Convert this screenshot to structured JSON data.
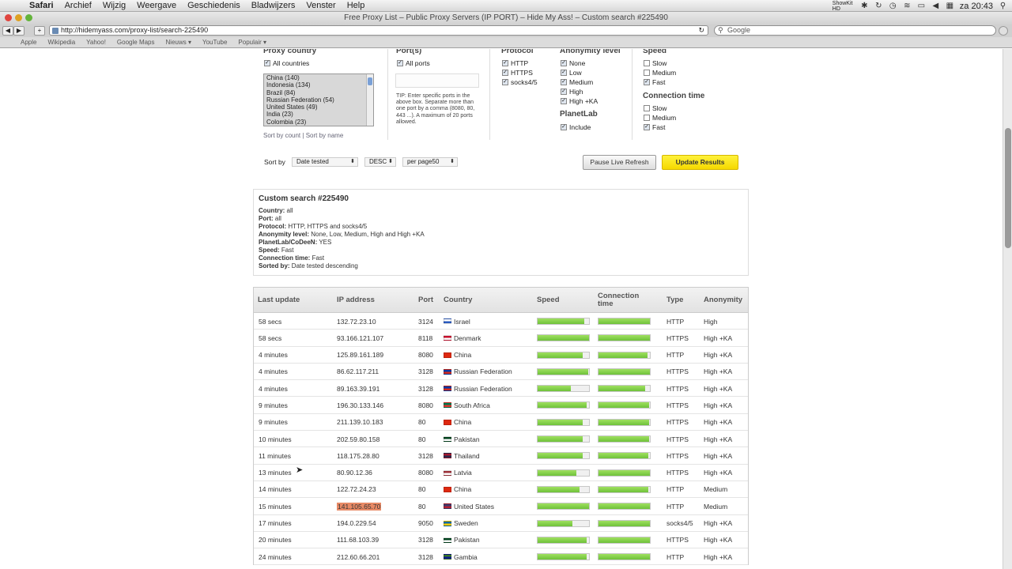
{
  "menubar": {
    "app": "Safari",
    "items": [
      "Archief",
      "Wijzig",
      "Weergave",
      "Geschiedenis",
      "Bladwijzers",
      "Venster",
      "Help"
    ],
    "clock": "za 20:43",
    "status_text": "ShowKit HD"
  },
  "window": {
    "title": "Free Proxy List – Public Proxy Servers (IP PORT) – Hide My Ass! – Custom search #225490"
  },
  "toolbar": {
    "url": "http://hidemyass.com/proxy-list/search-225490",
    "search_placeholder": "Google"
  },
  "bookmarks": [
    "Apple",
    "Wikipedia",
    "Yahoo!",
    "Google Maps",
    "Nieuws ▾",
    "YouTube",
    "Populair ▾"
  ],
  "filters": {
    "country_heading": "Proxy country",
    "all_countries": "All countries",
    "countries": [
      "China (140)",
      "Indonesia (134)",
      "Brazil (84)",
      "Russian Federation (54)",
      "United States (49)",
      "India (23)",
      "Colombia (23)"
    ],
    "sort_by_count": "Sort by count",
    "sort_sep": "|",
    "sort_by_name": "Sort by name",
    "port_heading": "Port(s)",
    "all_ports": "All ports",
    "port_tip": "TIP: Enter specific ports in the above box. Separate more than one port by a comma (8080, 80, 443 ...). A maximum of 20 ports allowed.",
    "protocol_heading": "Protocol",
    "protocols": [
      "HTTP",
      "HTTPS",
      "socks4/5"
    ],
    "anonymity_heading": "Anonymity level",
    "anonymity": [
      "None",
      "Low",
      "Medium",
      "High",
      "High +KA"
    ],
    "planetlab_heading": "PlanetLab",
    "planetlab_include": "Include",
    "speed_heading": "Speed",
    "speed": [
      {
        "label": "Slow",
        "checked": false
      },
      {
        "label": "Medium",
        "checked": false
      },
      {
        "label": "Fast",
        "checked": true
      }
    ],
    "conn_heading": "Connection time",
    "conn": [
      {
        "label": "Slow",
        "checked": false
      },
      {
        "label": "Medium",
        "checked": false
      },
      {
        "label": "Fast",
        "checked": true
      }
    ]
  },
  "sortbar": {
    "label": "Sort by",
    "field": "Date tested",
    "order": "DESC",
    "per_page": "per page50",
    "pause_button": "Pause Live Refresh",
    "update_button": "Update Results"
  },
  "summary": {
    "title": "Custom search #225490",
    "lines": [
      {
        "k": "Country:",
        "v": " all"
      },
      {
        "k": "Port:",
        "v": " all"
      },
      {
        "k": "Protocol:",
        "v": " HTTP, HTTPS and socks4/5"
      },
      {
        "k": "Anonymity level:",
        "v": " None, Low, Medium, High and High +KA"
      },
      {
        "k": "PlanetLab/CoDeeN:",
        "v": " YES"
      },
      {
        "k": "Speed:",
        "v": " Fast"
      },
      {
        "k": "Connection time:",
        "v": " Fast"
      },
      {
        "k": "Sorted by:",
        "v": " Date tested descending"
      }
    ]
  },
  "table": {
    "headers": [
      "Last update",
      "IP address",
      "Port",
      "Country",
      "Speed",
      "Connection time",
      "Type",
      "Anonymity"
    ],
    "rows": [
      {
        "update": "58 secs",
        "ip": "132.72.23.10",
        "port": "3124",
        "country": "Israel",
        "flag": [
          "#ffffff",
          "#2b5bbf"
        ],
        "speed": 0.9,
        "conn": 1.0,
        "type": "HTTP",
        "anon": "High"
      },
      {
        "update": "58 secs",
        "ip": "93.166.121.107",
        "port": "8118",
        "country": "Denmark",
        "flag": [
          "#c8102e",
          "#ffffff"
        ],
        "speed": 1.0,
        "conn": 1.0,
        "type": "HTTPS",
        "anon": "High +KA"
      },
      {
        "update": "4 minutes",
        "ip": "125.89.161.189",
        "port": "8080",
        "country": "China",
        "flag": [
          "#de2910",
          "#de2910"
        ],
        "speed": 0.87,
        "conn": 0.95,
        "type": "HTTP",
        "anon": "High +KA"
      },
      {
        "update": "4 minutes",
        "ip": "86.62.117.211",
        "port": "3128",
        "country": "Russian Federation",
        "flag": [
          "#0039a6",
          "#d52b1e"
        ],
        "speed": 0.98,
        "conn": 1.0,
        "type": "HTTPS",
        "anon": "High +KA"
      },
      {
        "update": "4 minutes",
        "ip": "89.163.39.191",
        "port": "3128",
        "country": "Russian Federation",
        "flag": [
          "#0039a6",
          "#d52b1e"
        ],
        "speed": 0.65,
        "conn": 0.9,
        "type": "HTTPS",
        "anon": "High +KA"
      },
      {
        "update": "9 minutes",
        "ip": "196.30.133.146",
        "port": "8080",
        "country": "South Africa",
        "flag": [
          "#007a4d",
          "#de3831"
        ],
        "speed": 0.95,
        "conn": 0.99,
        "type": "HTTPS",
        "anon": "High +KA"
      },
      {
        "update": "9 minutes",
        "ip": "211.139.10.183",
        "port": "80",
        "country": "China",
        "flag": [
          "#de2910",
          "#de2910"
        ],
        "speed": 0.88,
        "conn": 0.99,
        "type": "HTTPS",
        "anon": "High +KA"
      },
      {
        "update": "10 minutes",
        "ip": "202.59.80.158",
        "port": "80",
        "country": "Pakistan",
        "flag": [
          "#01411c",
          "#ffffff"
        ],
        "speed": 0.88,
        "conn": 0.99,
        "type": "HTTPS",
        "anon": "High +KA"
      },
      {
        "update": "11 minutes",
        "ip": "118.175.28.80",
        "port": "3128",
        "country": "Thailand",
        "flag": [
          "#a51931",
          "#2d2a4a"
        ],
        "speed": 0.88,
        "conn": 0.97,
        "type": "HTTPS",
        "anon": "High +KA"
      },
      {
        "update": "13 minutes",
        "ip": "80.90.12.36",
        "port": "8080",
        "country": "Latvia",
        "flag": [
          "#9e3039",
          "#ffffff"
        ],
        "speed": 0.75,
        "conn": 1.0,
        "type": "HTTPS",
        "anon": "High +KA"
      },
      {
        "update": "14 minutes",
        "ip": "122.72.24.23",
        "port": "80",
        "country": "China",
        "flag": [
          "#de2910",
          "#de2910"
        ],
        "speed": 0.82,
        "conn": 0.97,
        "type": "HTTP",
        "anon": "Medium"
      },
      {
        "update": "15 minutes",
        "ip": "141.105.65.70",
        "port": "80",
        "country": "United States",
        "flag": [
          "#3c3b6e",
          "#b22234"
        ],
        "speed": 1.0,
        "conn": 1.0,
        "type": "HTTP",
        "anon": "Medium",
        "highlight": true
      },
      {
        "update": "17 minutes",
        "ip": "194.0.229.54",
        "port": "9050",
        "country": "Sweden",
        "flag": [
          "#006aa7",
          "#fecc00"
        ],
        "speed": 0.68,
        "conn": 1.0,
        "type": "socks4/5",
        "anon": "High +KA"
      },
      {
        "update": "20 minutes",
        "ip": "111.68.103.39",
        "port": "3128",
        "country": "Pakistan",
        "flag": [
          "#01411c",
          "#ffffff"
        ],
        "speed": 0.95,
        "conn": 1.0,
        "type": "HTTPS",
        "anon": "High +KA"
      },
      {
        "update": "24 minutes",
        "ip": "212.60.66.201",
        "port": "3128",
        "country": "Gambia",
        "flag": [
          "#3a7728",
          "#0c1c8c"
        ],
        "speed": 0.95,
        "conn": 1.0,
        "type": "HTTP",
        "anon": "High +KA"
      }
    ]
  }
}
